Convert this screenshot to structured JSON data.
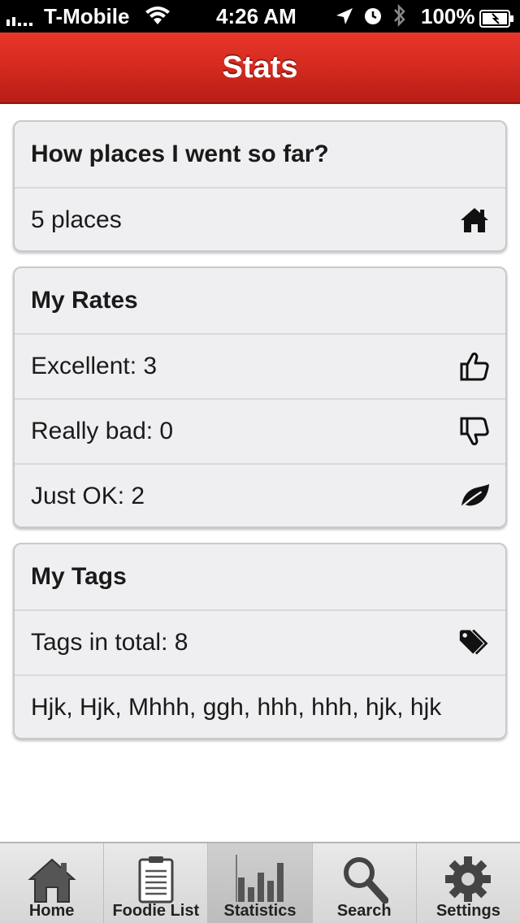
{
  "status_bar": {
    "carrier": "T-Mobile",
    "time": "4:26 AM",
    "battery": "100%"
  },
  "nav": {
    "title": "Stats"
  },
  "places_group": {
    "header": "How places I went so far?",
    "rows": [
      {
        "label": "5 places",
        "icon": "home-icon"
      }
    ]
  },
  "rates_group": {
    "header": "My Rates",
    "rows": [
      {
        "label": "Excellent: 3",
        "icon": "thumbs-up-icon"
      },
      {
        "label": "Really bad: 0",
        "icon": "thumbs-down-icon"
      },
      {
        "label": "Just OK: 2",
        "icon": "leaf-icon"
      }
    ]
  },
  "tags_group": {
    "header": "My Tags",
    "rows": [
      {
        "label": "Tags in total: 8",
        "icon": "tags-icon"
      },
      {
        "label": "Hjk, Hjk, Mhhh, ggh, hhh, hhh, hjk, hjk"
      }
    ]
  },
  "tab_bar": {
    "selected": "Statistics",
    "tabs": [
      {
        "label": "Home",
        "icon": "house-icon"
      },
      {
        "label": "Foodie List",
        "icon": "clipboard-icon"
      },
      {
        "label": "Statistics",
        "icon": "bar-chart-icon"
      },
      {
        "label": "Search",
        "icon": "magnifier-icon"
      },
      {
        "label": "Settings",
        "icon": "gear-icon"
      }
    ]
  },
  "colors": {
    "nav_red": "#d42a1f",
    "group_bg": "#efeff1",
    "tab_bar_bg": "#d6d6d6"
  }
}
